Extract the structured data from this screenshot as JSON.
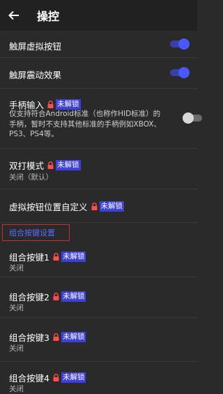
{
  "header": {
    "title": "操控"
  },
  "settings": {
    "touch_virtual_buttons": {
      "label": "触屏虚拟按钮",
      "enabled": true
    },
    "touch_vibration": {
      "label": "触屏震动效果",
      "enabled": true
    },
    "gamepad_input": {
      "label": "手柄输入",
      "badge": "未解锁",
      "description": "仅支持符合Android标准（也称作HID标准）的手柄，暂时不支持其他标准的手柄例如XBOX、PS3、PS4等。",
      "enabled": false
    },
    "dual_mode": {
      "label": "双打模式",
      "badge": "未解锁",
      "value": "关闭（默认）"
    },
    "custom_button_position": {
      "label": "虚拟按钮位置自定义",
      "badge": "未解锁"
    }
  },
  "combo_section": {
    "title": "组合按键设置",
    "items": [
      {
        "label": "组合按键1",
        "badge": "未解锁",
        "value": "关闭"
      },
      {
        "label": "组合按键2",
        "badge": "未解锁",
        "value": "关闭"
      },
      {
        "label": "组合按键3",
        "badge": "未解锁",
        "value": "关闭"
      },
      {
        "label": "组合按键4",
        "badge": "未解锁",
        "value": "关闭"
      }
    ]
  },
  "colors": {
    "accent": "#4a57ff",
    "badge": "#3d3fd9",
    "lock": "#ff4d4d",
    "section_border": "#cc2f2f"
  }
}
